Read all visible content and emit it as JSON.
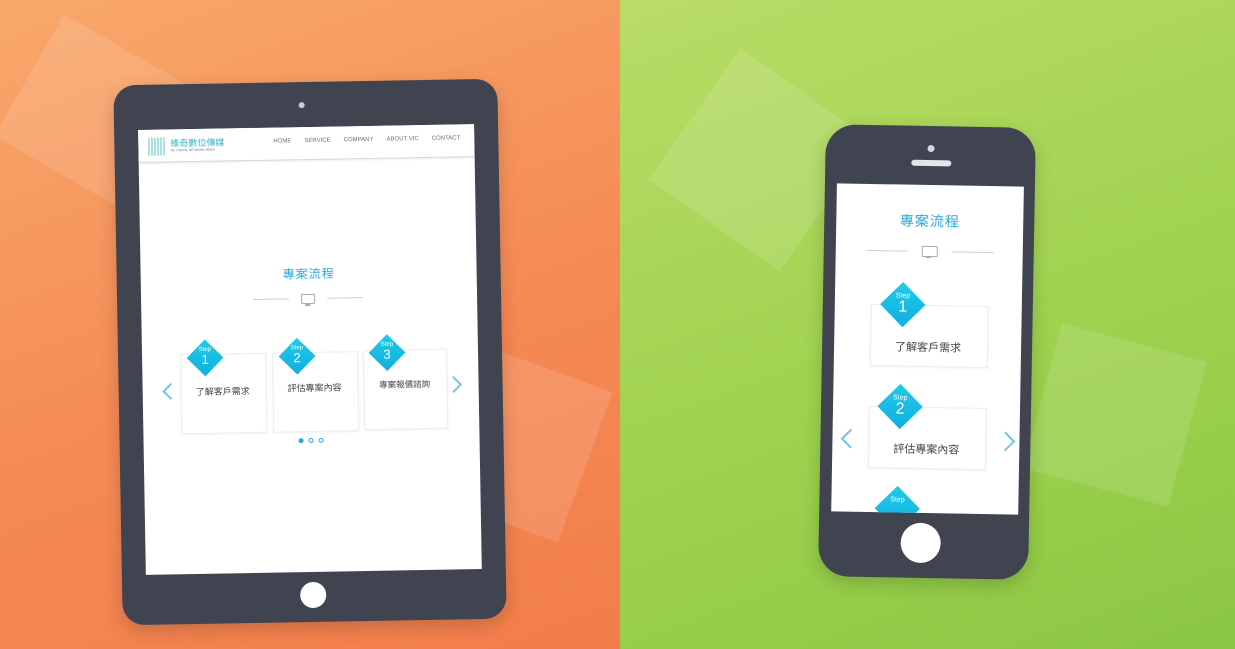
{
  "tablet": {
    "logo": {
      "name": "維奇數位傳媒",
      "subtitle": "VIC DIGITAL NETWORK MEDIA"
    },
    "nav": [
      "HOME",
      "SERVICE",
      "COMPANY",
      "ABOUT VIC",
      "CONTACT"
    ],
    "section_title": "專案流程",
    "step_word": "Step",
    "steps": [
      {
        "number": "1",
        "label": "了解客戶需求"
      },
      {
        "number": "2",
        "label": "評估專案內容"
      },
      {
        "number": "3",
        "label": "專案報價諮詢"
      }
    ],
    "pager": {
      "count": 3,
      "active": 1
    }
  },
  "phone": {
    "section_title": "專案流程",
    "step_word": "Step",
    "steps": [
      {
        "number": "1",
        "label": "了解客戶需求"
      },
      {
        "number": "2",
        "label": "評估專案內容"
      }
    ]
  },
  "colors": {
    "accent": "#29a9d9",
    "diamond": "#14b9e3",
    "left_background": "#f58a55",
    "right_background": "#9fd24e",
    "device_body": "#3f4450"
  },
  "icons": [
    "monitor-icon",
    "chevron-left-icon",
    "chevron-right-icon"
  ]
}
